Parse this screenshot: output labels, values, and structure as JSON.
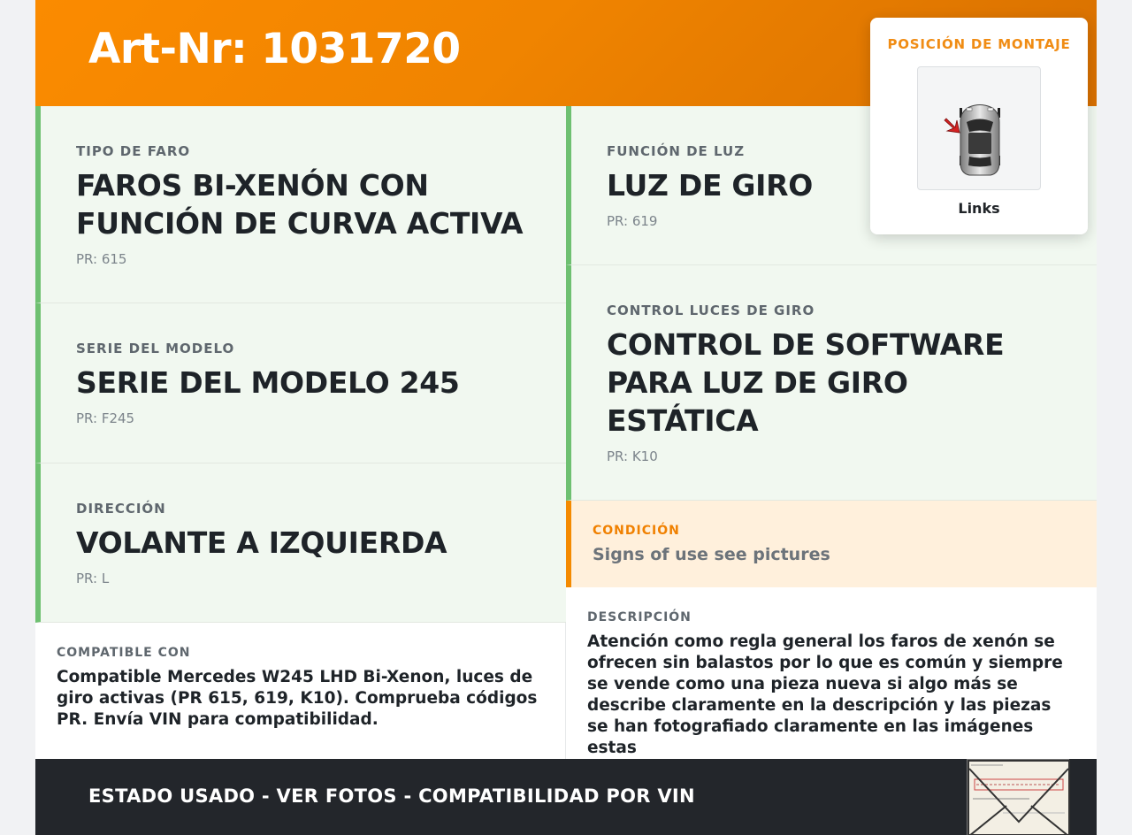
{
  "header": {
    "title": "Art-Nr: 1031720"
  },
  "specs_left": [
    {
      "label": "TIPO DE FARO",
      "value": "FAROS BI-XENÓN CON FUNCIÓN DE CURVA ACTIVA",
      "pr": "PR: 615"
    },
    {
      "label": "SERIE DEL MODELO",
      "value": "SERIE DEL MODELO 245",
      "pr": "PR: F245"
    },
    {
      "label": "DIRECCIÓN",
      "value": "VOLANTE A IZQUIERDA",
      "pr": "PR: L"
    }
  ],
  "specs_right": [
    {
      "label": "FUNCIÓN DE LUZ",
      "value": "LUZ DE GIRO",
      "pr": "PR: 619"
    },
    {
      "label": "CONTROL LUCES DE GIRO",
      "value": "CONTROL DE SOFTWARE PARA LUZ DE GIRO ESTÁTICA",
      "pr": "PR: K10"
    }
  ],
  "condition": {
    "label": "CONDICIÓN",
    "value": "Signs of use see pictures"
  },
  "compatible": {
    "label": "COMPATIBLE CON",
    "text": "Compatible Mercedes W245 LHD Bi-Xenon, luces de giro activas (PR 615, 619, K10). Comprueba códigos PR. Envía VIN para compatibilidad."
  },
  "description": {
    "label": "DESCRIPCIÓN",
    "text": "Atención como regla general los faros de xenón se ofrecen sin balastos por lo que es común y siempre se vende como una pieza nueva si algo más se describe claramente en la descripción y las piezas se han fotografiado claramente en las imágenes estas"
  },
  "mounting": {
    "title": "POSICIÓN DE MONTAJE",
    "side": "Links",
    "icon": "car-top-view-icon",
    "arrow_color": "#d32222"
  },
  "footer": {
    "text": "ESTADO USADO - VER FOTOS - COMPATIBILIDAD POR VIN",
    "doc_icon": "vin-document-icon"
  },
  "colors": {
    "brand_orange": "#f48a00",
    "spec_accent": "#6ec071",
    "spec_bg": "#f1f8f0",
    "condition_bg": "#fff0dc",
    "footer_bg": "#23262b"
  }
}
